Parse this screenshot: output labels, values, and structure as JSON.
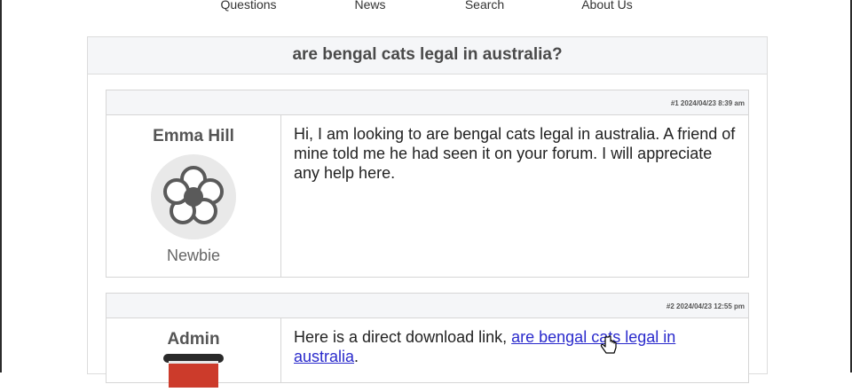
{
  "nav": {
    "items": [
      "Questions",
      "News",
      "Search",
      "About Us"
    ]
  },
  "thread": {
    "title": "are bengal cats legal in australia?"
  },
  "posts": [
    {
      "meta": "#1 2024/04/23 8:39 am",
      "author": "Emma Hill",
      "rank": "Newbie",
      "avatar_icon": "flower-icon",
      "text": "Hi, I am looking to are bengal cats legal in australia. A friend of mine told me he had seen it on your forum. I will appreciate any help here."
    },
    {
      "meta": "#2 2024/04/23 12:55 pm",
      "author": "Admin",
      "avatar_icon": "jar-icon",
      "text_prefix": "Here is a direct download link, ",
      "link_text": "are bengal cats legal in australia",
      "text_suffix": "."
    }
  ],
  "colors": {
    "link": "#2a2acc",
    "header_bg": "#f5f6f8",
    "border": "#d6d6d6"
  }
}
